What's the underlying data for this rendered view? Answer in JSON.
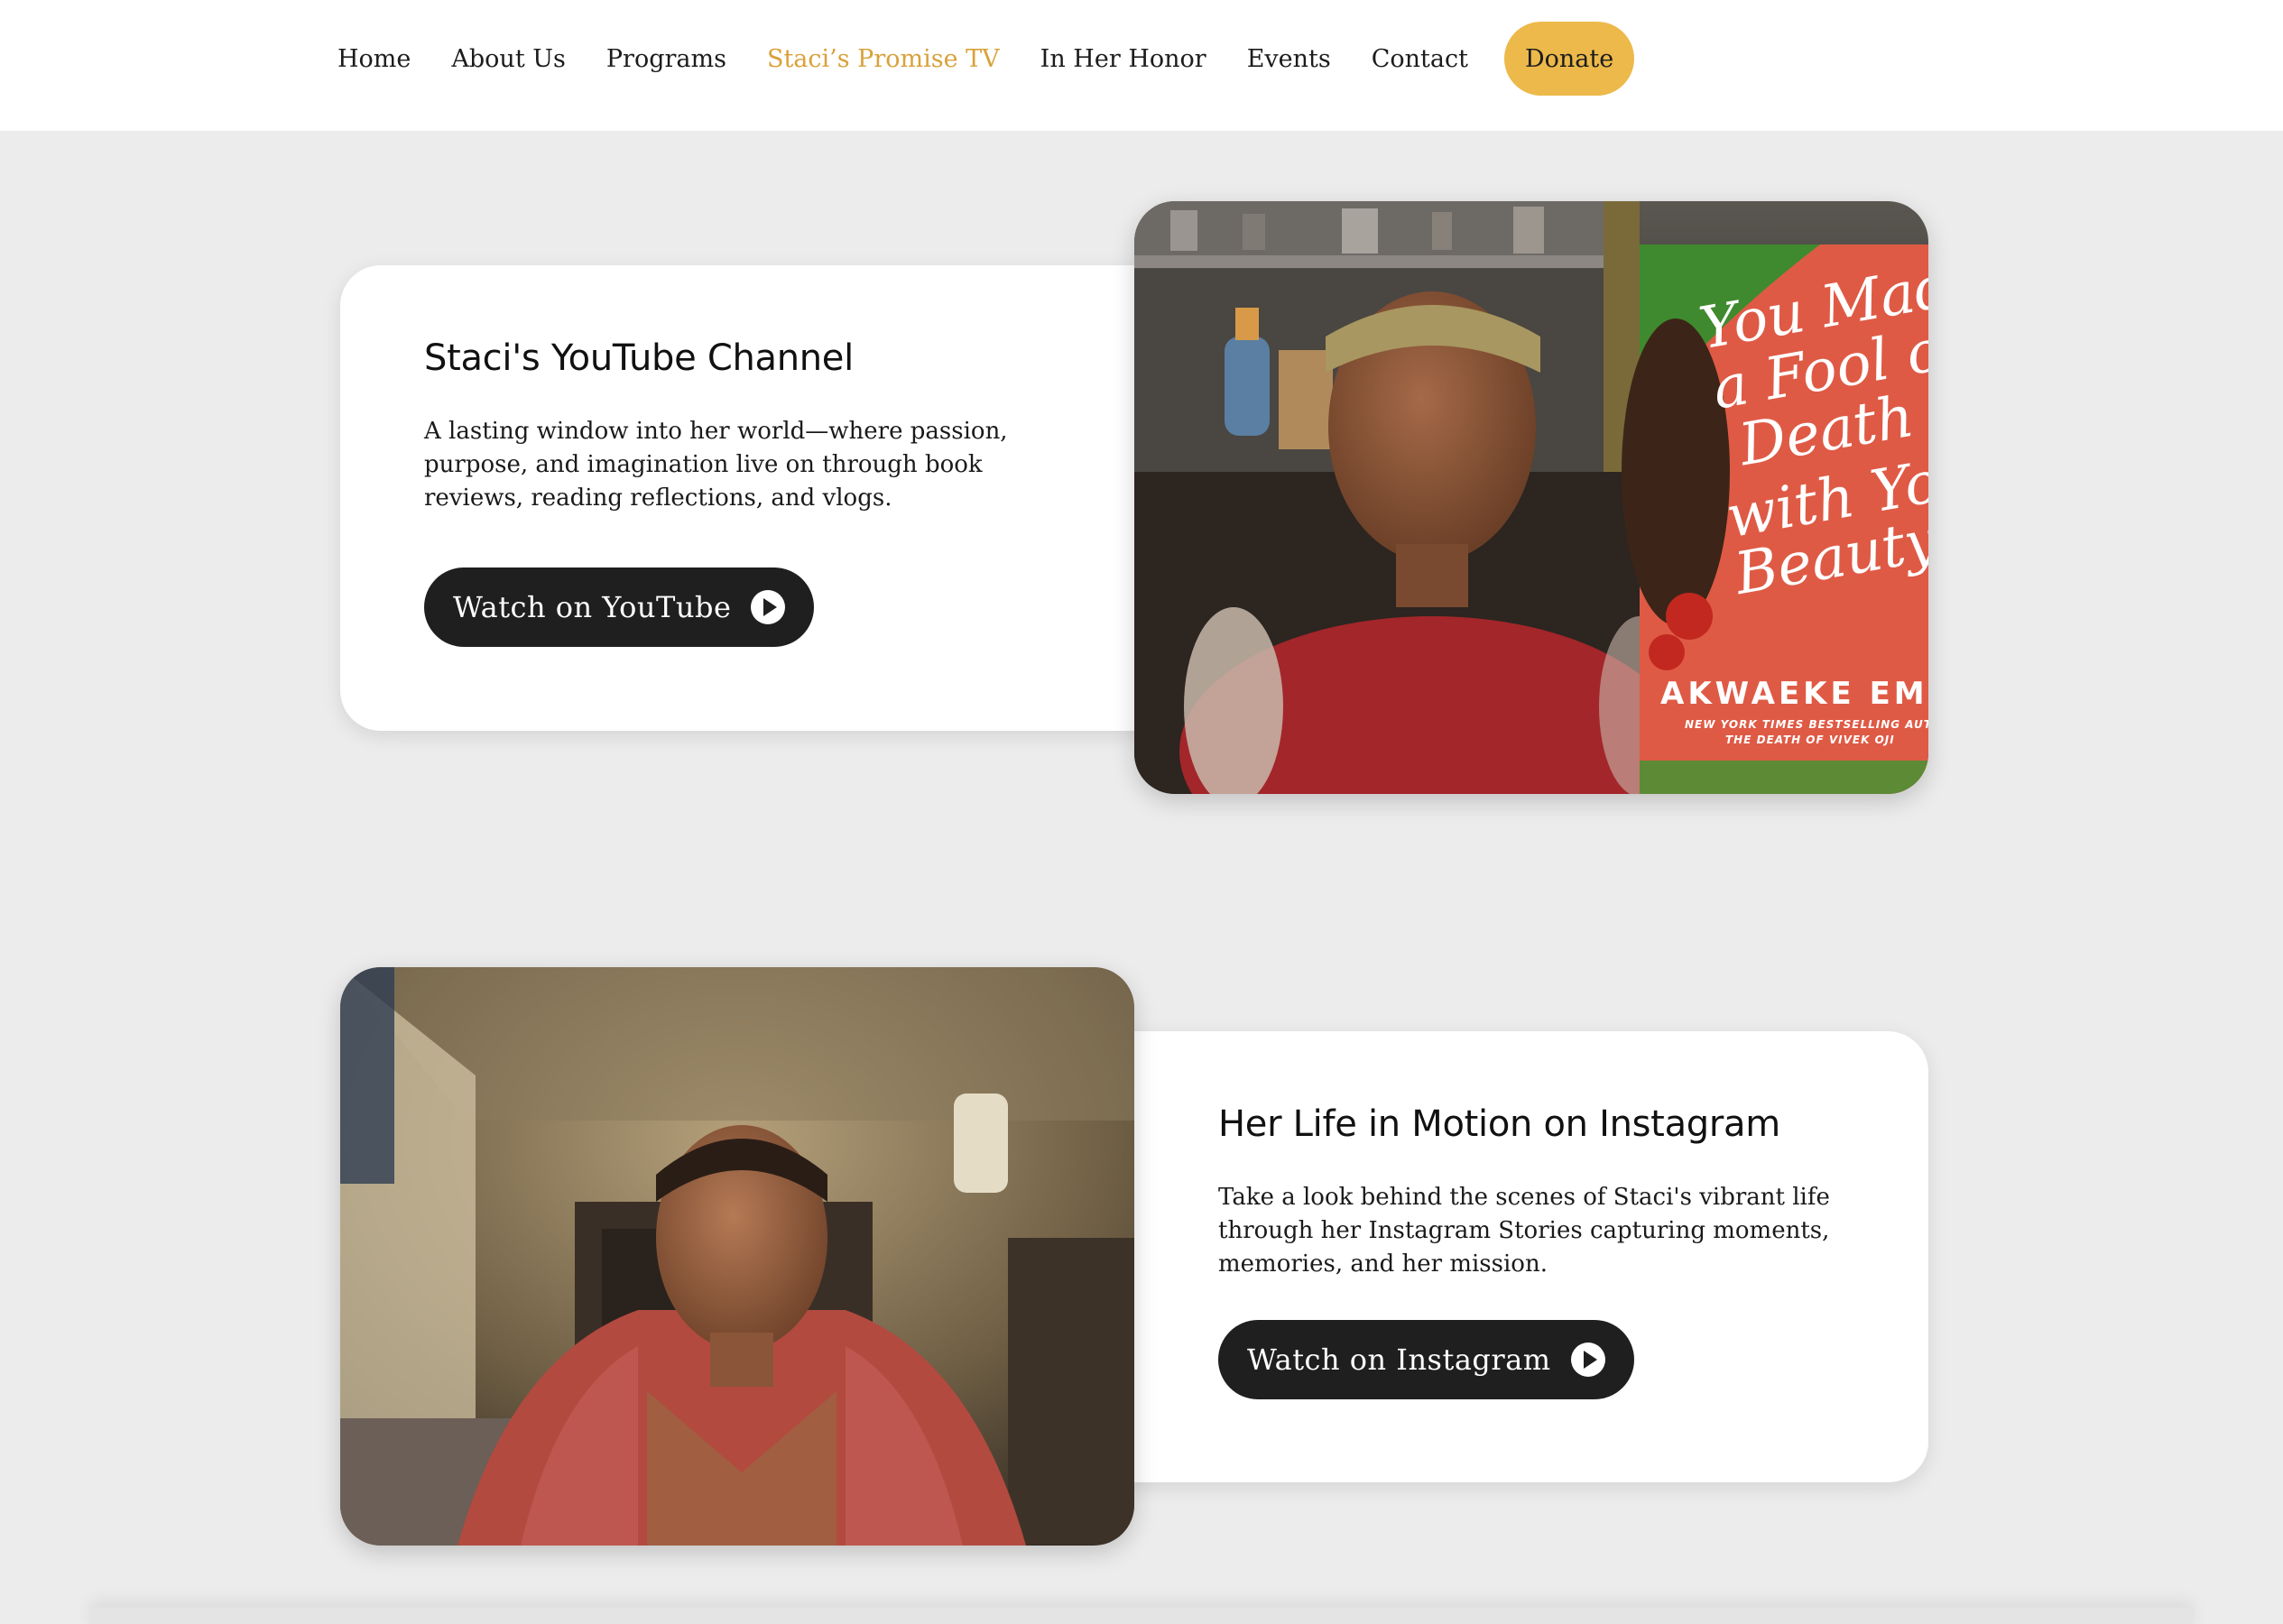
{
  "nav": {
    "items": [
      {
        "label": "Home",
        "active": false
      },
      {
        "label": "About Us",
        "active": false
      },
      {
        "label": "Programs",
        "active": false
      },
      {
        "label": "Staci’s Promise TV",
        "active": true
      },
      {
        "label": "In Her Honor",
        "active": false
      },
      {
        "label": "Events",
        "active": false
      },
      {
        "label": "Contact",
        "active": false
      }
    ],
    "donate_label": "Donate"
  },
  "youtube": {
    "title": "Staci's YouTube Channel",
    "description": "A lasting window into her world—where passion, purpose, and imagination live on through book reviews, reading reflections, and vlogs.",
    "button_label": "Watch on YouTube",
    "book": {
      "title_lines": [
        "You Made",
        "a Fool of",
        "Death",
        "with Your",
        "Beauty"
      ],
      "author": "AKWAEKE EMEZI",
      "subtitle_lines": [
        "NEW YORK TIMES BESTSELLING AUTHOR OF",
        "THE DEATH OF VIVEK OJI"
      ]
    }
  },
  "instagram": {
    "title": "Her Life in Motion on Instagram",
    "description": "Take a look behind the scenes of Staci's vibrant life through her Instagram Stories capturing moments, memories, and her mission.",
    "button_label": "Watch on Instagram"
  },
  "colors": {
    "accent": "#ecb94a",
    "active_link": "#d9a13a",
    "button_bg": "#1f1f1f",
    "page_bg": "#ececec"
  }
}
